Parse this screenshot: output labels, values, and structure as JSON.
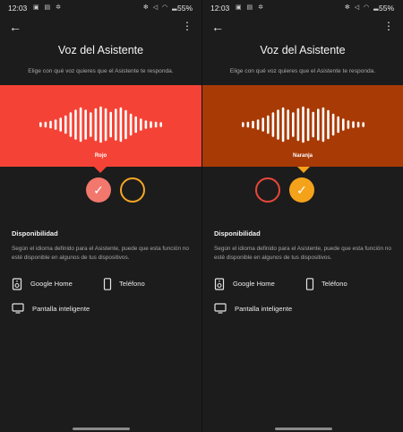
{
  "screens": [
    {
      "status": {
        "time": "12:03",
        "battery": "55%"
      },
      "title": "Voz del Asistente",
      "subtitle": "Elige con qué voz quieres que el Asistente te responda.",
      "selected_color_name": "Rojo",
      "section_title": "Disponibilidad",
      "description": "Según el idioma definido para el Asistente, puede que esta función no esté disponible en algunos de tus dispositivos.",
      "devices": {
        "speaker": "Google Home",
        "phone": "Teléfono",
        "display": "Pantalla inteligente"
      },
      "colors": {
        "banner": "#f44336",
        "swatch_selected": "#f2776c",
        "swatch_other_ring": "#f5a623"
      }
    },
    {
      "status": {
        "time": "12:03",
        "battery": "55%"
      },
      "title": "Voz del Asistente",
      "subtitle": "Elige con qué voz quieres que el Asistente te responda.",
      "selected_color_name": "Naranja",
      "section_title": "Disponibilidad",
      "description": "Según el idioma definido para el Asistente, puede que esta función no esté disponible en algunos de tus dispositivos.",
      "devices": {
        "speaker": "Google Home",
        "phone": "Teléfono",
        "display": "Pantalla inteligente"
      },
      "colors": {
        "banner": "#a83a06",
        "swatch_selected": "#f5a21b",
        "swatch_other_ring": "#e8473a"
      }
    }
  ]
}
